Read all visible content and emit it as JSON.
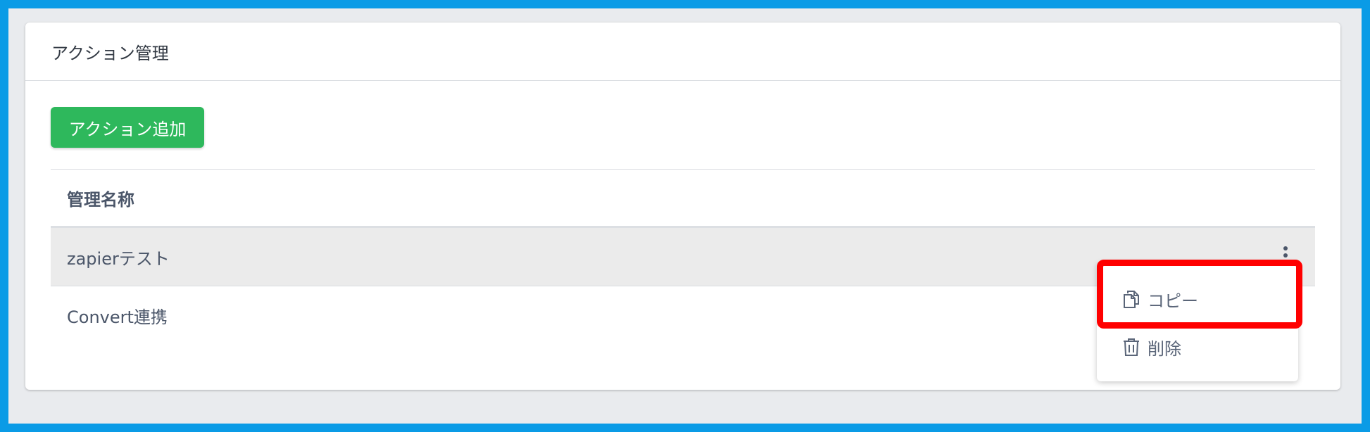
{
  "card": {
    "title": "アクション管理"
  },
  "toolbar": {
    "add_label": "アクション追加"
  },
  "table": {
    "columns": [
      "管理名称"
    ],
    "rows": [
      {
        "name": "zapierテスト"
      },
      {
        "name": "Convert連携"
      }
    ]
  },
  "context_menu": {
    "items": [
      {
        "label": "コピー",
        "icon": "copy-icon"
      },
      {
        "label": "削除",
        "icon": "trash-icon"
      }
    ]
  },
  "colors": {
    "outer_border": "#0a9be6",
    "page_bg": "#e9ebee",
    "primary_button": "#2eb85c",
    "highlight": "#ff0000",
    "row_hover": "#ebebeb"
  }
}
